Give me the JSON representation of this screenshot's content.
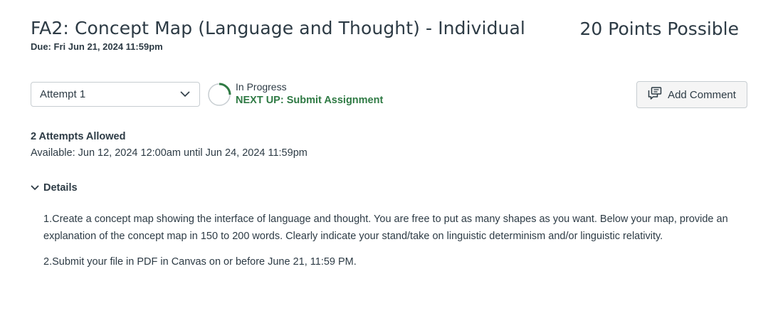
{
  "assignment": {
    "title": "FA2: Concept Map (Language and Thought) - Individual",
    "due": "Due: Fri Jun 21, 2024 11:59pm",
    "points": "20 Points Possible"
  },
  "attempt": {
    "selected": "Attempt 1",
    "status": "In Progress",
    "next_up": "NEXT UP: Submit Assignment",
    "progress_fraction": 0.25
  },
  "actions": {
    "add_comment": "Add Comment"
  },
  "info": {
    "attempts_allowed": "2 Attempts Allowed",
    "available": "Available: Jun 12, 2024 12:00am until Jun 24, 2024 11:59pm"
  },
  "details": {
    "heading": "Details",
    "paragraphs": [
      "1.Create a concept map showing the interface of language and thought. You are free to put as many shapes as you want. Below your map, provide an explanation of the concept map in 150 to 200 words. Clearly indicate your stand/take on linguistic determinism and/or linguistic relativity.",
      "2.Submit your file in PDF in Canvas on or before June 21, 11:59 PM."
    ]
  },
  "colors": {
    "text": "#2d3b45",
    "success": "#2f7a44",
    "border": "#c7cdd1"
  },
  "icons": {
    "dropdown": "chevron-down-icon",
    "progress": "progress-ring-icon",
    "comment": "comment-icon",
    "details_toggle": "chevron-down-icon"
  }
}
